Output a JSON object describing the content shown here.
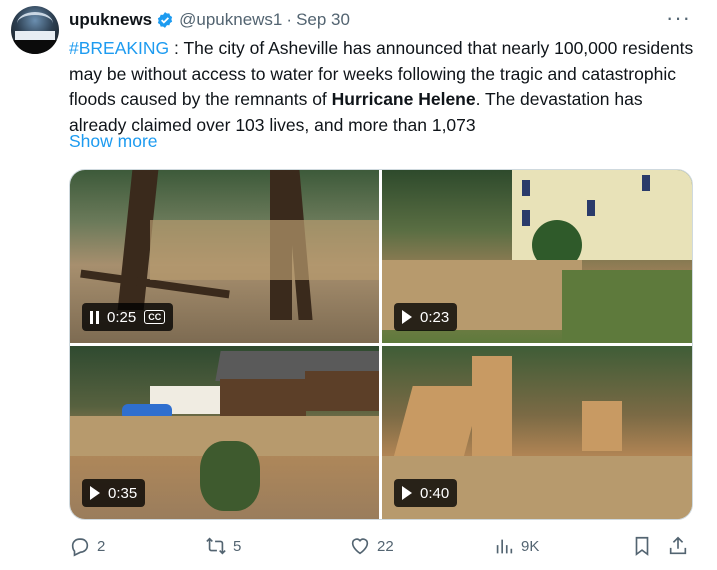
{
  "tweet": {
    "author_name": "upuknews",
    "handle": "@upuknews1",
    "separator": "·",
    "date": "Sep 30",
    "more_label": "···",
    "hashtag": "#BREAKING",
    "text_part1": " : The city of Asheville has announced that nearly 100,000 residents may be without access to water for weeks following the tragic and catastrophic floods caused by the remnants of ",
    "text_bold": "Hurricane Helene",
    "text_part2": ". The devastation has already claimed over 103 lives, and more than 1,073",
    "show_more": "Show more"
  },
  "media": [
    {
      "duration": "0:25",
      "state": "playing",
      "captions": "CC"
    },
    {
      "duration": "0:23",
      "state": "paused"
    },
    {
      "duration": "0:35",
      "state": "paused"
    },
    {
      "duration": "0:40",
      "state": "paused"
    }
  ],
  "actions": {
    "replies": "2",
    "reposts": "5",
    "likes": "22",
    "views": "9K"
  },
  "colors": {
    "accent": "#1d9bf0",
    "text": "#0f1419",
    "muted": "#536471"
  }
}
